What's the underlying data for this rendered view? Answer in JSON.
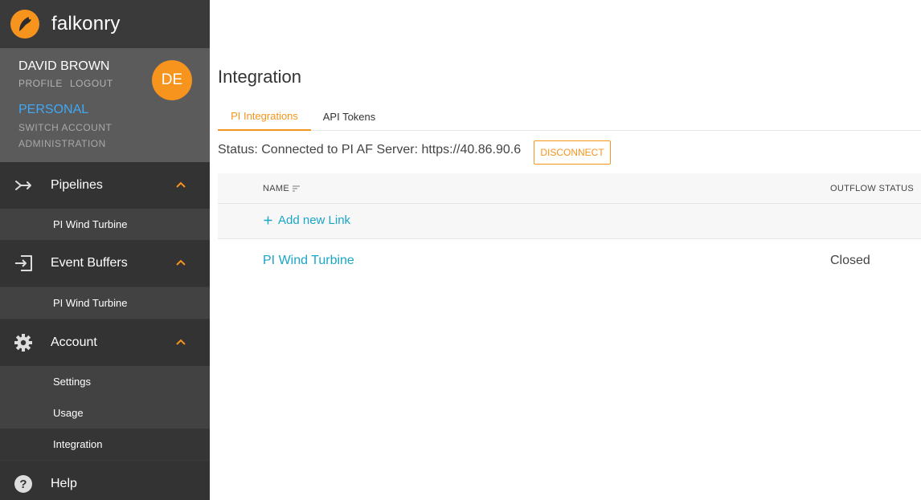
{
  "brand": {
    "name": "falkonry",
    "accent": "#f7941d"
  },
  "user": {
    "name": "DAVID BROWN",
    "profile_label": "PROFILE",
    "logout_label": "LOGOUT",
    "initials": "DE",
    "account_type": "PERSONAL",
    "switch_account_label": "SWITCH ACCOUNT",
    "administration_label": "ADMINISTRATION"
  },
  "sidebar": {
    "groups": [
      {
        "label": "Pipelines",
        "icon": "merge-arrow-icon",
        "items": [
          {
            "label": "PI Wind Turbine"
          }
        ]
      },
      {
        "label": "Event Buffers",
        "icon": "input-icon",
        "items": [
          {
            "label": "PI Wind Turbine"
          }
        ]
      },
      {
        "label": "Account",
        "icon": "gear-icon",
        "items": [
          {
            "label": "Settings"
          },
          {
            "label": "Usage"
          },
          {
            "label": "Integration",
            "active": true
          }
        ]
      },
      {
        "label": "Help",
        "icon": "help-circle-icon",
        "items": []
      }
    ]
  },
  "main": {
    "title": "Integration",
    "tabs": [
      {
        "label": "PI Integrations",
        "active": true
      },
      {
        "label": "API Tokens",
        "active": false
      }
    ],
    "status_text": "Status: Connected to PI AF Server: https://40.86.90.6",
    "disconnect_label": "DISCONNECT",
    "table": {
      "columns": [
        {
          "label": "NAME",
          "icon": "sort-icon"
        },
        {
          "label": "OUTFLOW STATUS"
        }
      ],
      "add_link_label": "Add new Link",
      "rows": [
        {
          "name": "PI Wind Turbine",
          "status": "Closed"
        }
      ]
    }
  },
  "colors": {
    "sidebar_bg": "#3a3a3a",
    "user_panel_bg": "#5b5b5b",
    "link": "#1aa6c7",
    "personal": "#3fa9f5"
  }
}
